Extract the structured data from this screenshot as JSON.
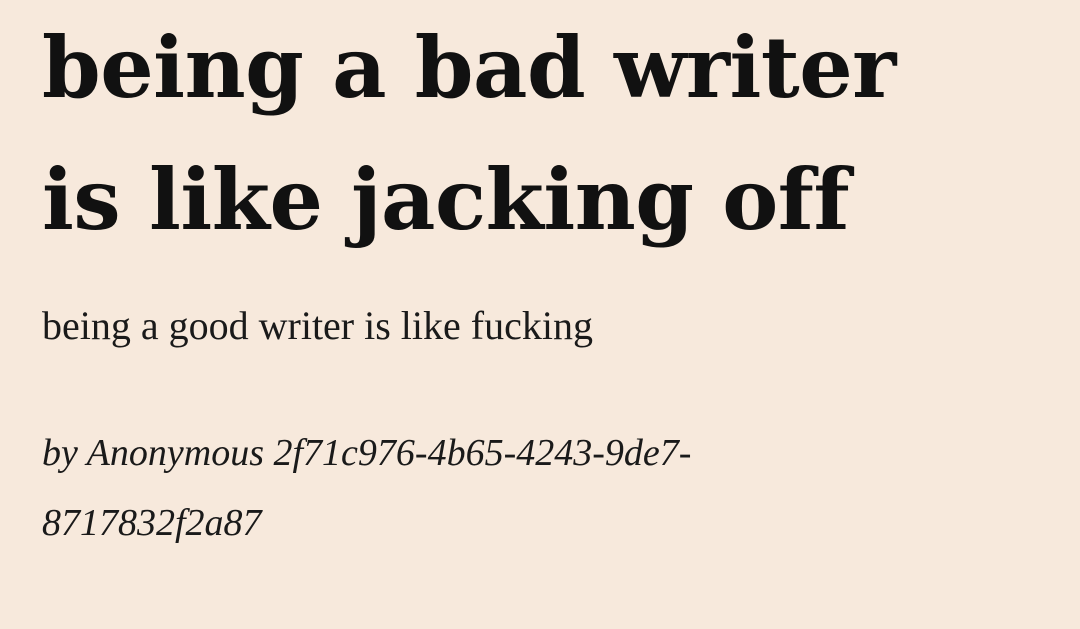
{
  "poem": {
    "title_lines": [
      "being a bad writer",
      "is like jacking off"
    ],
    "subtitle": "being a good writer is like fucking",
    "byline_lines": [
      "by Anonymous 2f71c976-4b65-4243-9de7-",
      "8717832f2a87"
    ]
  },
  "colors": {
    "background": "#f7e9dc",
    "text": "#111111"
  }
}
